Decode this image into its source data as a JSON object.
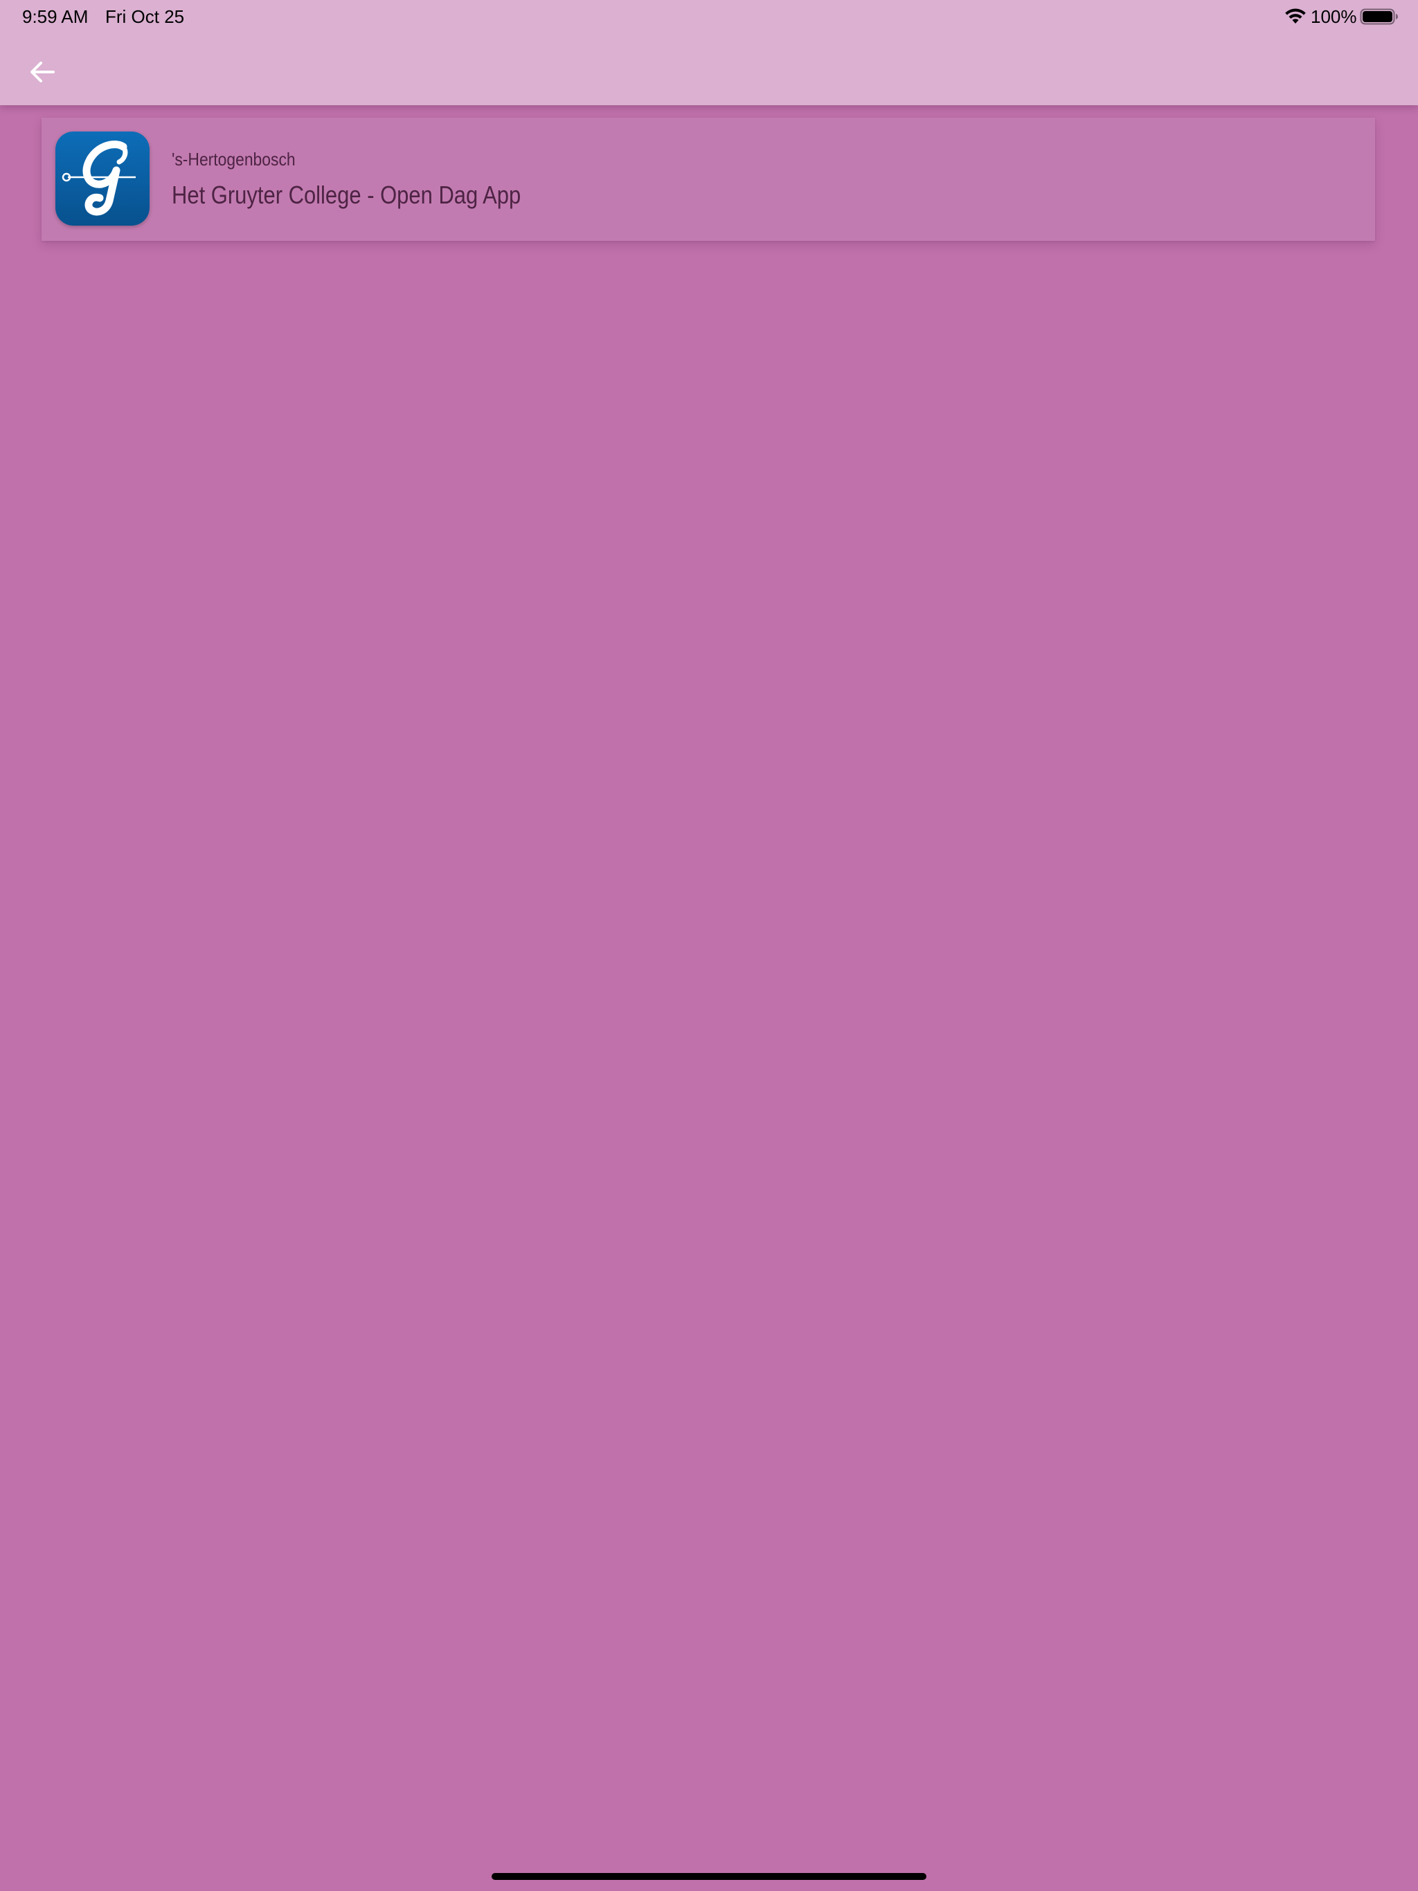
{
  "status_bar": {
    "time": "9:59 AM",
    "date": "Fri Oct 25",
    "battery_percent": "100%",
    "battery_level": 1.0,
    "icons": [
      "wifi-icon",
      "battery-icon"
    ]
  },
  "app_bar": {
    "back_icon": "arrow-left-icon",
    "color": "#dbb0d1"
  },
  "list": {
    "items": [
      {
        "icon": "school-app-logo",
        "subtitle": "'s-Hertogenbosch",
        "title": "Het Gruyter College - Open Dag App"
      }
    ]
  },
  "colors": {
    "background": "#c071ab",
    "text": "#4d2344",
    "logo_blue": "#0a5fa3"
  }
}
